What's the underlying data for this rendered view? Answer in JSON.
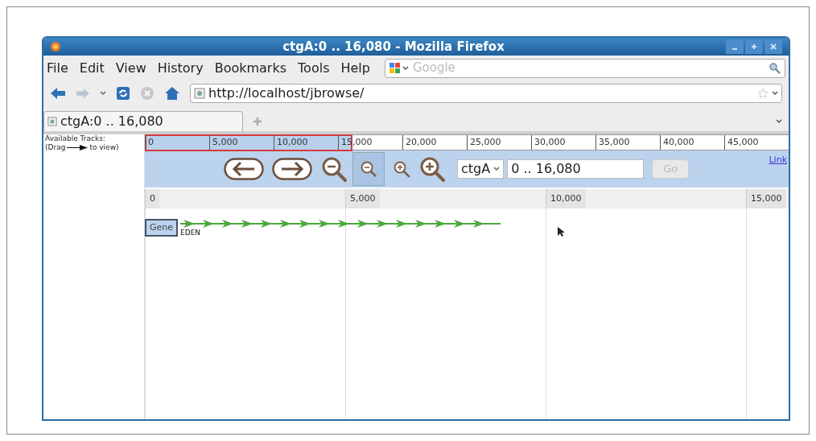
{
  "window": {
    "title": "ctgA:0 .. 16,080 - Mozilla Firefox"
  },
  "menu": [
    "File",
    "Edit",
    "View",
    "History",
    "Bookmarks",
    "Tools",
    "Help"
  ],
  "search": {
    "placeholder": "Google"
  },
  "address": {
    "url": "http://localhost/jbrowse/"
  },
  "tabs": [
    {
      "label": "ctgA:0 .. 16,080",
      "selected": true
    }
  ],
  "sidebar": {
    "title": "Available Tracks:",
    "hint_start": "(Drag",
    "hint_end": "to view)"
  },
  "overview": {
    "ticks": [
      "0",
      "5,000",
      "10,000",
      "15,000",
      "20,000",
      "25,000",
      "30,000",
      "35,000",
      "40,000",
      "45,000"
    ]
  },
  "navigation": {
    "ref_seq": "ctgA",
    "location": "0 .. 16,080",
    "go": "Go",
    "link": "Link"
  },
  "ruler": {
    "ticks": [
      "0",
      "5,000",
      "10,000",
      "15,000"
    ]
  },
  "tracks": [
    {
      "label": "Gene",
      "feature": "EDEN"
    }
  ]
}
